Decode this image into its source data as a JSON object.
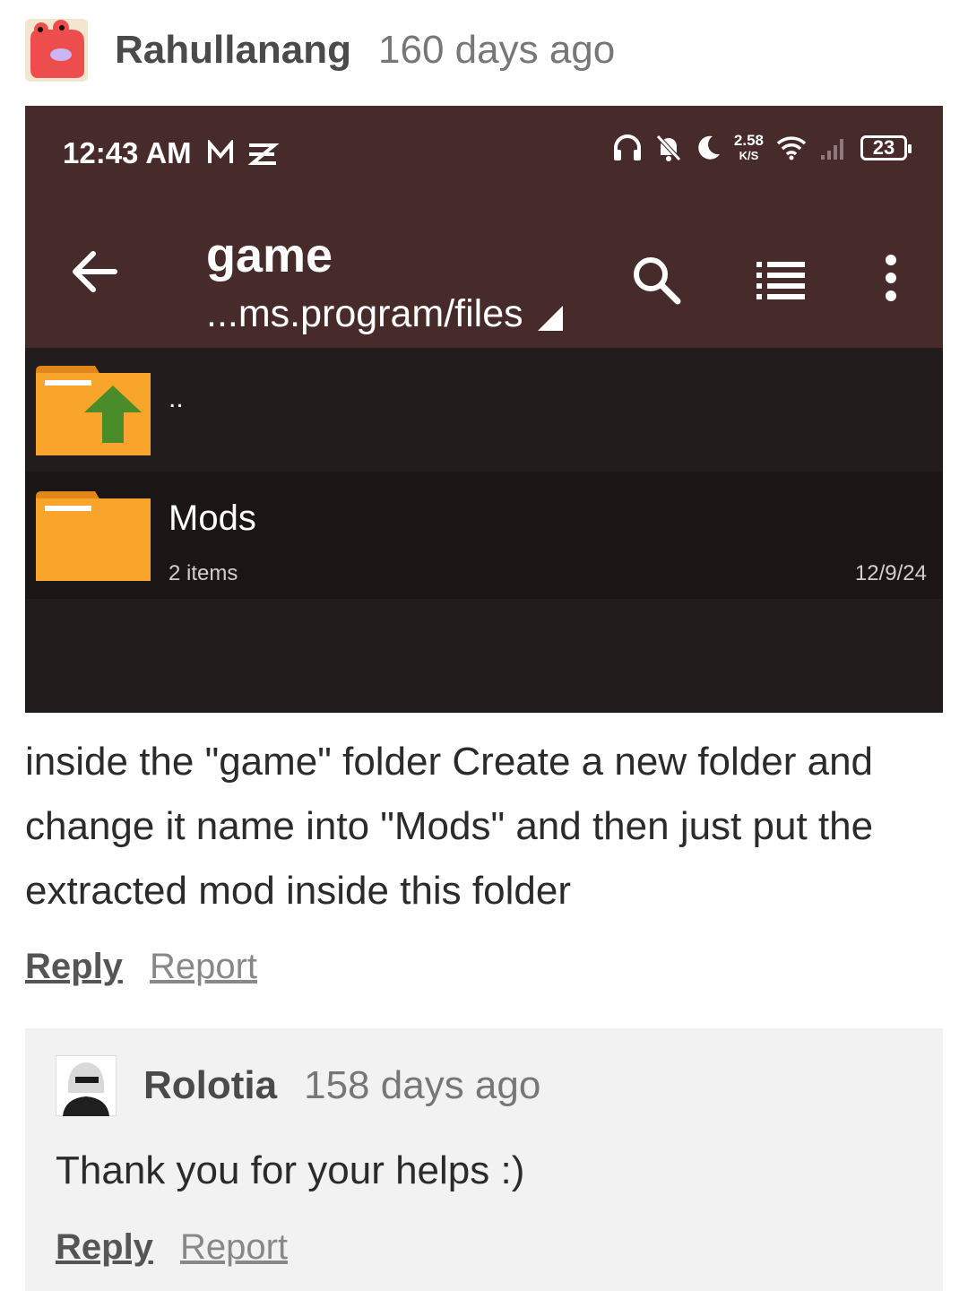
{
  "comment": {
    "author": "Rahullanang",
    "time": "160 days ago",
    "text": "inside the \"game\" folder Create a new folder and change it name into \"Mods\" and then just put the extracted mod inside this folder",
    "reply_label": "Reply",
    "report_label": "Report"
  },
  "screenshot": {
    "status": {
      "time": "12:43 AM",
      "speed_value": "2.58",
      "speed_unit": "K/S",
      "battery": "23"
    },
    "app_bar": {
      "title": "game",
      "path": "...ms.program/files"
    },
    "files": [
      {
        "name": "..",
        "sub": "",
        "date": ""
      },
      {
        "name": "Mods",
        "sub": "2 items",
        "date": "12/9/24"
      }
    ]
  },
  "reply": {
    "author": "Rolotia",
    "time": "158 days ago",
    "text": "Thank you for your helps :)",
    "reply_label": "Reply",
    "report_label": "Report"
  },
  "colors": {
    "app_bar": "#472b2b",
    "list_bg": "#231c1c",
    "folder": "#f9a52b",
    "up_arrow": "#4a8c2a"
  }
}
